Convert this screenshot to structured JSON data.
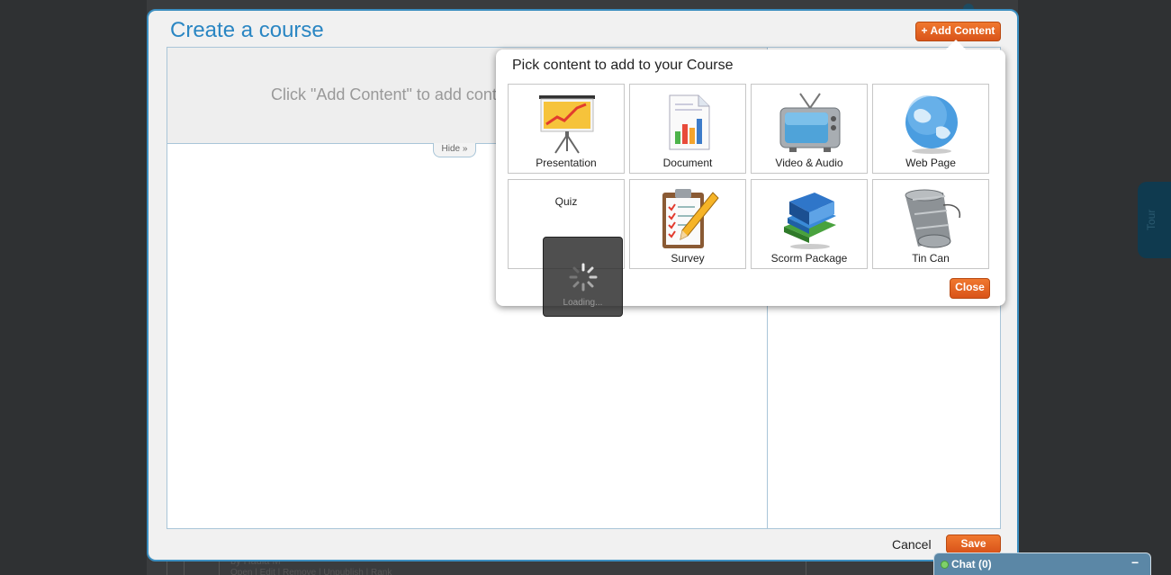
{
  "modal": {
    "title": "Create a course",
    "add_content_label": "+ Add Content",
    "placeholder": "Click \"Add Content\" to add content",
    "hide_label": "Hide",
    "cancel_label": "Cancel",
    "save_label": "Save"
  },
  "popup": {
    "title": "Pick content to add to your Course",
    "close_label": "Close",
    "tiles": [
      {
        "label": "Presentation",
        "icon": "presentation-icon"
      },
      {
        "label": "Document",
        "icon": "document-icon"
      },
      {
        "label": "Video & Audio",
        "icon": "tv-icon"
      },
      {
        "label": "Web Page",
        "icon": "globe-icon"
      },
      {
        "label": "Quiz",
        "icon": ""
      },
      {
        "label": "Survey",
        "icon": "clipboard-icon"
      },
      {
        "label": "Scorm Package",
        "icon": "books-icon"
      },
      {
        "label": "Tin Can",
        "icon": "tin-can-icon"
      }
    ]
  },
  "loading": {
    "label": "Loading..."
  },
  "background": {
    "author": "by Hadia M",
    "links": "Open | Edit | Remove | Unpublish | Rank",
    "tour_label": "Tour"
  },
  "chat": {
    "label": "Chat  (0)",
    "minimize": "−"
  },
  "colors": {
    "accent": "#2a86c3",
    "button": "#e2621f",
    "modal_border": "#3b8ec0"
  }
}
